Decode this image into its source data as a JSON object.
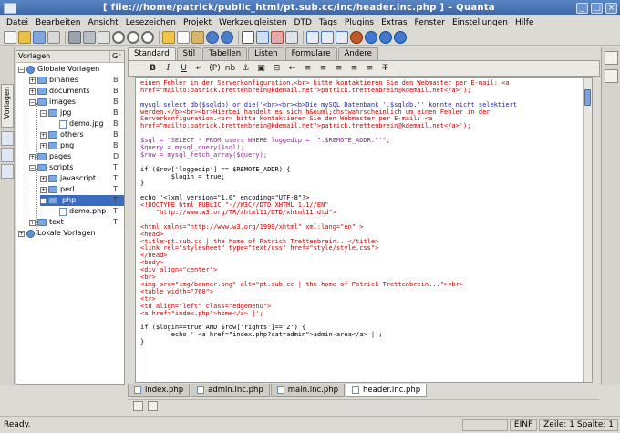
{
  "window": {
    "title": "[ file:///home/patrick/public_html/pt.sub.cc/inc/header.inc.php ] – Quanta",
    "controls": [
      "_",
      "□",
      "×"
    ]
  },
  "menubar": [
    "Datei",
    "Bearbeiten",
    "Ansicht",
    "Lesezeichen",
    "Projekt",
    "Werkzeugleisten",
    "DTD",
    "Tags",
    "Plugins",
    "Extras",
    "Fenster",
    "Einstellungen",
    "Hilfe"
  ],
  "sidetabs": {
    "vorlagen": "Vorlagen"
  },
  "tree": {
    "header_name": "Vorlagen",
    "header_col2": "Gr",
    "items": [
      {
        "label": "Globale Vorlagen",
        "type": "globe",
        "col2": ""
      },
      {
        "label": "binaries",
        "type": "folder",
        "col2": "B"
      },
      {
        "label": "documents",
        "type": "folder",
        "col2": "B"
      },
      {
        "label": "images",
        "type": "folder",
        "col2": "B"
      },
      {
        "label": "jpg",
        "type": "folder",
        "col2": "B"
      },
      {
        "label": "demo.jpg",
        "type": "file",
        "col2": "B"
      },
      {
        "label": "others",
        "type": "folder",
        "col2": "B"
      },
      {
        "label": "png",
        "type": "folder",
        "col2": "B"
      },
      {
        "label": "pages",
        "type": "folder",
        "col2": "D"
      },
      {
        "label": "scripts",
        "type": "folder",
        "col2": "T"
      },
      {
        "label": "javascript",
        "type": "folder",
        "col2": "T"
      },
      {
        "label": "perl",
        "type": "folder",
        "col2": "T"
      },
      {
        "label": "php",
        "type": "folder",
        "col2": "T"
      },
      {
        "label": "demo.php",
        "type": "file",
        "col2": "T"
      },
      {
        "label": "text",
        "type": "folder",
        "col2": "T"
      },
      {
        "label": "Lokale Vorlagen",
        "type": "globe",
        "col2": ""
      }
    ]
  },
  "editor": {
    "toolbar_tabs": [
      "Standard",
      "Stil",
      "Tabellen",
      "Listen",
      "Formulare",
      "Andere"
    ],
    "active_toolbar_tab": "Standard",
    "quick_buttons": [
      "B",
      "I",
      "U",
      "↵",
      "(P)",
      "nb",
      "⚓",
      "▣",
      "⊟",
      "←",
      "≡",
      "≡",
      "≡",
      "≡",
      "≡",
      "T̶"
    ],
    "code_lines": [
      {
        "c": "red",
        "t": "einen Fehler in der Serverkonfiguration.<br> bitte kontaktieren Sie den Webmaster per E-mail: <a"
      },
      {
        "c": "red",
        "t": "href=\"mailto:patrick.trettenbrein@kdemail.net\">patrick.trettenbrein@kdemail.net</a>');"
      },
      {
        "c": "red",
        "t": ""
      },
      {
        "c": "blue",
        "t": "mysql_select_db($sqldb) or die('<br><br><b>Die mySQL Datenbank '.$sqldb.'' konnte nicht selektiert"
      },
      {
        "c": "red",
        "t": "werden.</b><br><br>Hierbei handelt es sich h&ouml;chstwahrscheinlich um einen Fehler in der"
      },
      {
        "c": "red",
        "t": "Serverkonfiguration.<br> bitte kontaktieren Sie den Webmaster per E-mail: <a"
      },
      {
        "c": "red",
        "t": "href=\"mailto:patrick.trettenbrein@kdemail.net\">patrick.trettenbrein@kdemail.net</a>');"
      },
      {
        "c": "red",
        "t": ""
      },
      {
        "c": "purple",
        "t": "$sql = \"SELECT * FROM users WHERE loggedip = '\".$REMOTE_ADDR.\"'\";"
      },
      {
        "c": "purple",
        "t": "$query = mysql_query($sql);"
      },
      {
        "c": "purple",
        "t": "$row = mysql_fetch_array($query);"
      },
      {
        "c": "red",
        "t": ""
      },
      {
        "c": "black",
        "t": "if ($row['loggedip'] == $REMOTE_ADDR) {"
      },
      {
        "c": "black",
        "t": "        $login = true;"
      },
      {
        "c": "black",
        "t": "}"
      },
      {
        "c": "red",
        "t": ""
      },
      {
        "c": "black",
        "t": "echo '<?xml version=\"1.0\" encoding=\"UTF-8\"?>"
      },
      {
        "c": "red",
        "t": "<!DOCTYPE html PUBLIC \"-//W3C//DTD XHTML 1.1//EN\""
      },
      {
        "c": "red",
        "t": "    \"http://www.w3.org/TR/xhtml11/DTD/xhtml11.dtd\">"
      },
      {
        "c": "red",
        "t": ""
      },
      {
        "c": "red",
        "t": "<html xmlns=\"http://www.w3.org/1999/xhtml\" xml:lang=\"en\" >"
      },
      {
        "c": "red",
        "t": "<head>"
      },
      {
        "c": "red",
        "t": "<title>pt.sub.cc | the home of Patrick Trettenbrein...</title>"
      },
      {
        "c": "red",
        "t": "<link rel=\"stylesheet\" type=\"text/css\" href=\"style/style.css\">"
      },
      {
        "c": "red",
        "t": "</head>"
      },
      {
        "c": "red",
        "t": "<body>"
      },
      {
        "c": "red",
        "t": "<div align=\"center\">"
      },
      {
        "c": "red",
        "t": "<br>"
      },
      {
        "c": "red",
        "t": "<img src=\"img/banner.png\" alt=\"pt.sub.cc | the home of Patrick Trettenbrein...\"><br>"
      },
      {
        "c": "red",
        "t": "<table width=\"760\">"
      },
      {
        "c": "red",
        "t": "<tr>"
      },
      {
        "c": "red",
        "t": "<td align=\"left\" class=\"edgemenu\">"
      },
      {
        "c": "red",
        "t": "<a href=\"index.php\">home</a> |';"
      },
      {
        "c": "red",
        "t": ""
      },
      {
        "c": "black",
        "t": "if ($login==true AND $row['rights']=='2') {"
      },
      {
        "c": "black",
        "t": "        echo ' <a href=\"index.php?cat=admin\">admin-area</a> |';"
      },
      {
        "c": "black",
        "t": "}"
      }
    ]
  },
  "doc_tabs": [
    "index.php",
    "admin.inc.php",
    "main.inc.php",
    "header.inc.php"
  ],
  "active_doc_tab": "header.inc.php",
  "status": {
    "message": "Ready.",
    "mode": "EINF",
    "position": "Zeile: 1 Spalte: 1"
  },
  "colors": {
    "titlebar": "#3c64a6",
    "selection": "#3b6bbf",
    "code_red": "#cc0000",
    "code_blue": "#2222aa",
    "code_purple": "#8a2b90"
  }
}
